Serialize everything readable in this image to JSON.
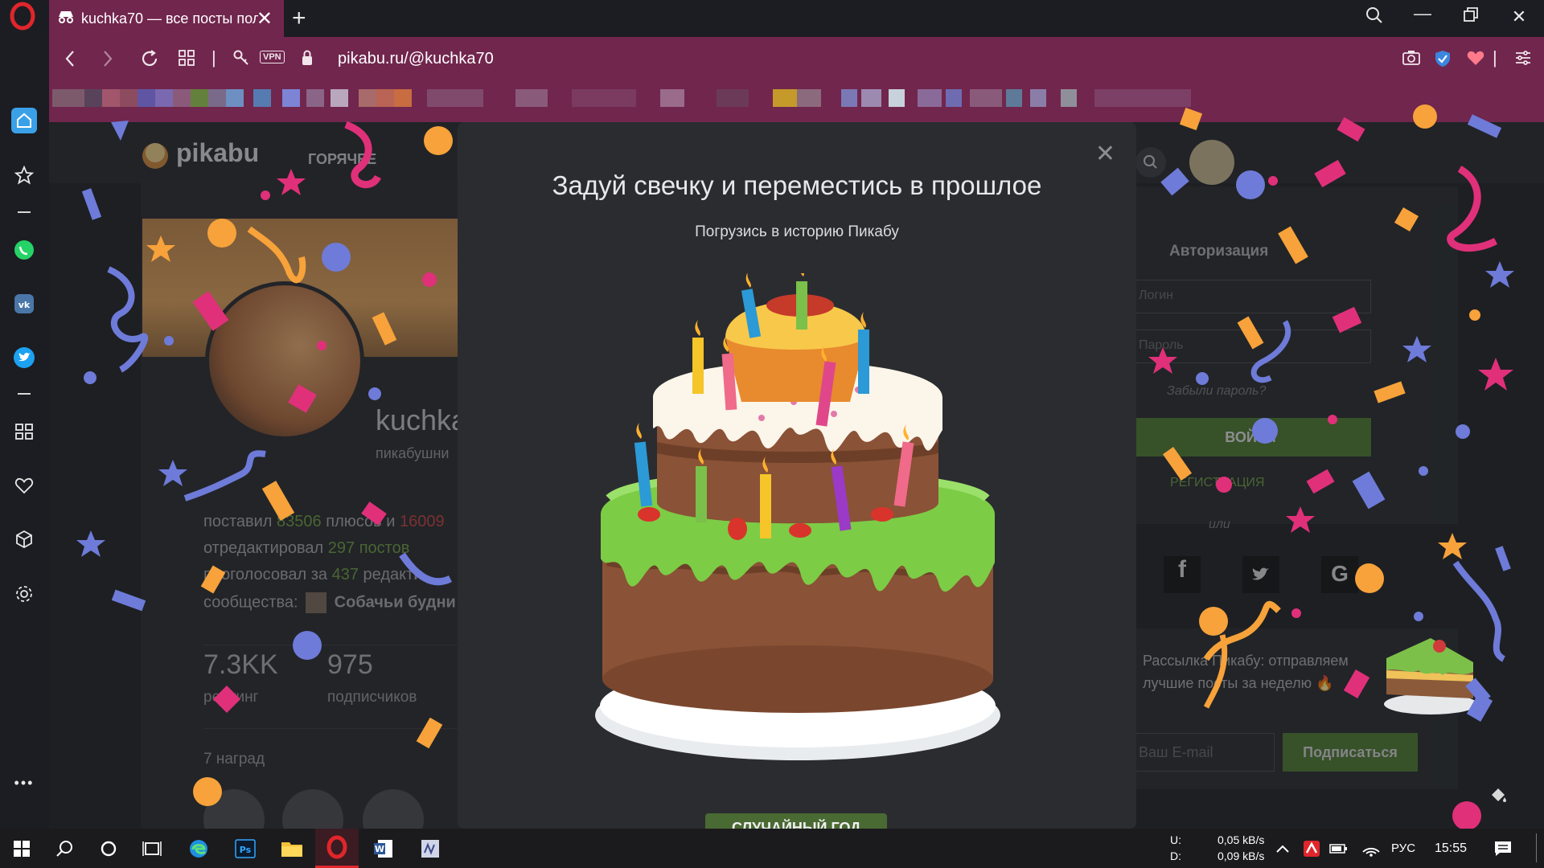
{
  "browser": {
    "tab_title": "kuchka70 — все посты пол",
    "url": "pikabu.ru/@kuchka70",
    "vpn_label": "VPN"
  },
  "page": {
    "logo_text": "pikabu",
    "nav_hot": "ГОРЯЧЕЕ",
    "username": "kuchka",
    "user_subtitle": "пикабушни",
    "stats": {
      "line1_prefix": "поставил",
      "pluses": "83506",
      "line1_mid": "плюсов и",
      "minuses": "16009",
      "line2_prefix": "отредактировал",
      "line2_value": "297 постов",
      "line3_prefix": "проголосовал за",
      "line3_value": "437",
      "line3_suffix": "редакти",
      "line4_prefix": "сообщества:",
      "line4_value": "Собачьи будни"
    },
    "rating_value": "7.3KK",
    "rating_label": "рейтинг",
    "subs_value": "975",
    "subs_label": "подписчиков",
    "awards_label": "7 наград",
    "auth": {
      "title": "Авторизация",
      "login_placeholder": "Логин",
      "password_placeholder": "Пароль",
      "forgot": "Забыли пароль?",
      "login_button": "ВОЙТИ",
      "register": "РЕГИСТРАЦИЯ",
      "or": "или"
    },
    "newsletter": {
      "text1": "Рассылка Пикабу: отправляем",
      "text2": "лучшие посты за неделю 🔥",
      "email_placeholder": "Ваш E-mail",
      "subscribe_button": "Подписаться"
    }
  },
  "modal": {
    "title": "Задуй свечку и переместись в прошлое",
    "subtitle": "Погрузись в историю Пикабу",
    "random_year_button": "СЛУЧАЙНЫЙ ГОД"
  },
  "taskbar": {
    "net_up_label": "U:",
    "net_up": "0,05 kB/s",
    "net_down_label": "D:",
    "net_down": "0,09 kB/s",
    "lang": "РУС",
    "time": "15:55"
  },
  "colors": {
    "opera_tab": "#71264d",
    "pikabu_green": "#6f9f3f",
    "pikabu_red": "#c94040",
    "modal_bg": "#2b2c30"
  }
}
